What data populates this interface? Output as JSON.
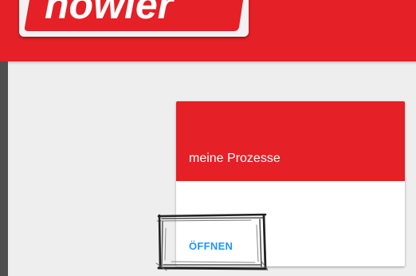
{
  "header": {
    "logo_text": "howler",
    "brand_color": "#e52026"
  },
  "card": {
    "title": "meine Prozesse",
    "action_label": "ÖFFNEN",
    "action_color": "#2196f3"
  }
}
